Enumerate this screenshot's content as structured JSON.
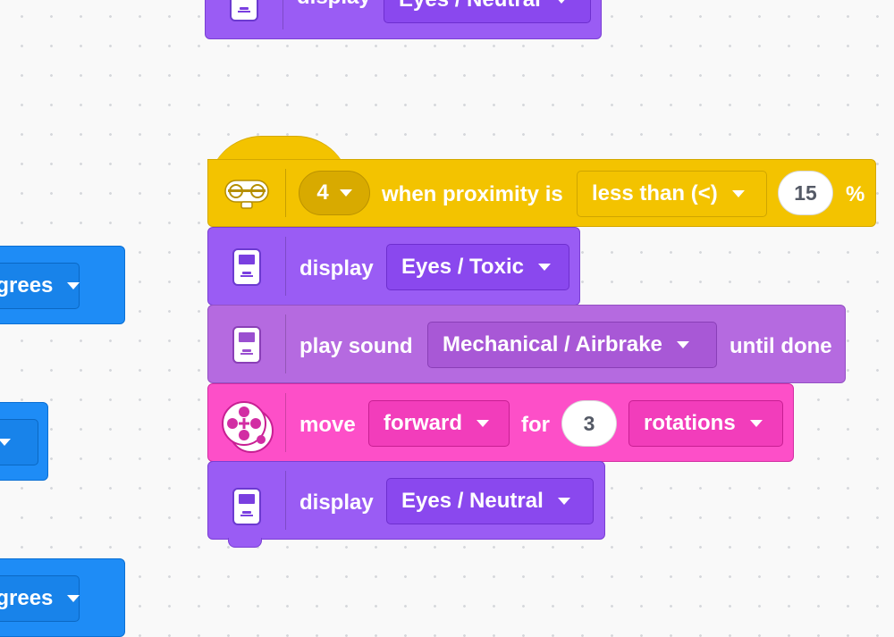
{
  "top_block": {
    "label": "display",
    "dropdown": "Eyes / Neutral"
  },
  "hat_block": {
    "port": "4",
    "label": "when proximity is",
    "comparator": "less than (<)",
    "value": "15",
    "unit": "%"
  },
  "display_block_1": {
    "label": "display",
    "dropdown": "Eyes / Toxic"
  },
  "sound_block": {
    "label": "play sound",
    "dropdown": "Mechanical / Airbrake",
    "suffix": "until done"
  },
  "move_block": {
    "label": "move",
    "direction": "forward",
    "for_label": "for",
    "value": "3",
    "unit": "rotations"
  },
  "display_block_2": {
    "label": "display",
    "dropdown": "Eyes / Neutral"
  },
  "left_blocks": {
    "degrees_1": "egrees",
    "degrees_3": "egrees"
  },
  "colors": {
    "display": "#9a5cf4",
    "sound": "#b56ae0",
    "move": "#fd4fc8",
    "event": "#f3c300",
    "motor": "#1e8cf6"
  }
}
